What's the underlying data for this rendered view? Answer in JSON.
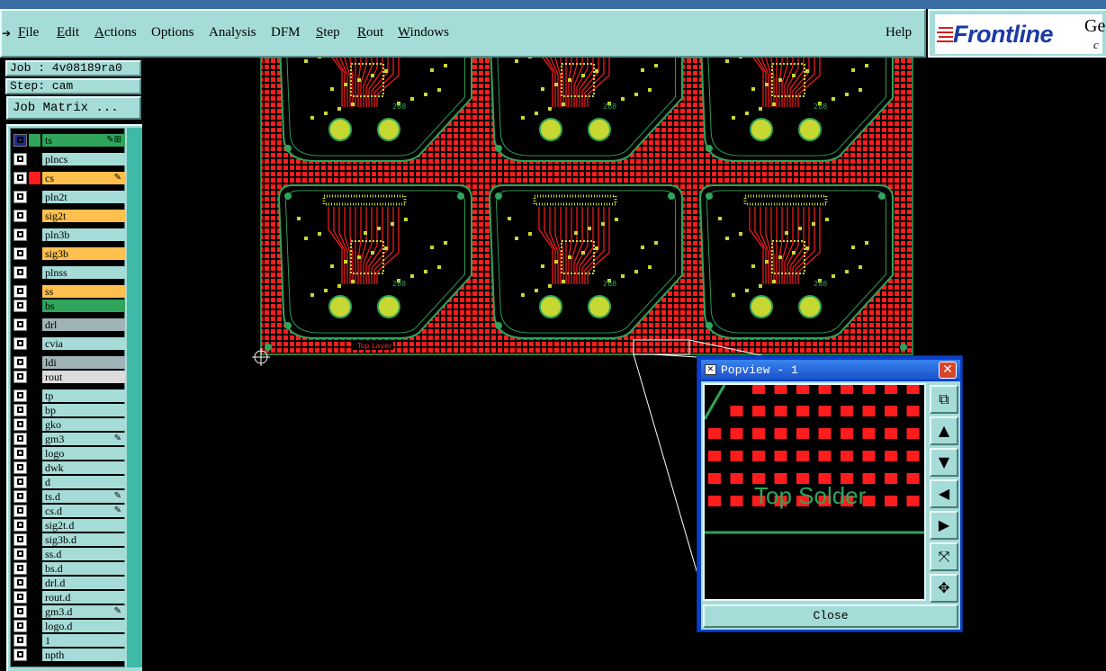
{
  "menu": {
    "items": [
      {
        "label": "File",
        "u": "F",
        "rest": "ile"
      },
      {
        "label": "Edit",
        "u": "E",
        "rest": "dit"
      },
      {
        "label": "Actions",
        "u": "A",
        "rest": "ctions"
      },
      {
        "label": "Options",
        "u": "",
        "rest": "Options"
      },
      {
        "label": "Analysis",
        "u": "",
        "rest": "Analysis"
      },
      {
        "label": "DFM",
        "u": "",
        "rest": "DFM"
      },
      {
        "label": "Step",
        "u": "S",
        "rest": "tep"
      },
      {
        "label": "Rout",
        "u": "R",
        "rest": "out"
      },
      {
        "label": "Windows",
        "u": "W",
        "rest": "indows"
      }
    ],
    "help": "Help"
  },
  "logo": {
    "word": "Frontline",
    "ge": "Ge",
    "c": "c"
  },
  "job_label": "Job : 4v08189ra0",
  "step_label": "Step: cam",
  "job_matrix_button": "Job Matrix ...",
  "layers": [
    {
      "name": "ts",
      "color": "#2ea55a",
      "swatch": "#2ea55a",
      "check_bg": "#1e2a8a",
      "mark": "✎⊞"
    },
    {
      "name": "plncs",
      "color": "#a6dcd8",
      "swatch": "",
      "mark": ""
    },
    {
      "name": "cs",
      "color": "#ffc04d",
      "swatch": "#ff1c1c",
      "mark": "✎"
    },
    {
      "name": "pln2t",
      "color": "#a6dcd8",
      "swatch": "",
      "mark": ""
    },
    {
      "name": "sig2t",
      "color": "#ffc04d",
      "swatch": "",
      "mark": ""
    },
    {
      "name": "pln3b",
      "color": "#a6dcd8",
      "swatch": "",
      "mark": ""
    },
    {
      "name": "sig3b",
      "color": "#ffc04d",
      "swatch": "",
      "mark": ""
    },
    {
      "name": "plnss",
      "color": "#a6dcd8",
      "swatch": "",
      "mark": ""
    },
    {
      "name": "ss",
      "color": "#ffc04d",
      "swatch": "",
      "mark": ""
    },
    {
      "name": "bs",
      "color": "#2ea55a",
      "swatch": "",
      "mark": ""
    },
    {
      "name": "drl",
      "color": "#a0b4b8",
      "swatch": "",
      "mark": ""
    },
    {
      "name": "cvia",
      "color": "#a6dcd8",
      "swatch": "",
      "mark": ""
    },
    {
      "name": "ldi",
      "color": "#a0b4b8",
      "swatch": "",
      "mark": ""
    },
    {
      "name": "rout",
      "color": "#dcdcdc",
      "swatch": "",
      "mark": ""
    },
    {
      "name": "tp",
      "color": "#a6dcd8",
      "swatch": "",
      "mark": ""
    },
    {
      "name": "bp",
      "color": "#a6dcd8",
      "swatch": "",
      "mark": ""
    },
    {
      "name": "gko",
      "color": "#a6dcd8",
      "swatch": "",
      "mark": ""
    },
    {
      "name": "gm3",
      "color": "#a6dcd8",
      "swatch": "",
      "mark": "✎"
    },
    {
      "name": "logo",
      "color": "#a6dcd8",
      "swatch": "",
      "mark": ""
    },
    {
      "name": "dwk",
      "color": "#a6dcd8",
      "swatch": "",
      "mark": ""
    },
    {
      "name": "d",
      "color": "#a6dcd8",
      "swatch": "",
      "mark": ""
    },
    {
      "name": "ts.d",
      "color": "#a6dcd8",
      "swatch": "",
      "mark": "✎"
    },
    {
      "name": "cs.d",
      "color": "#a6dcd8",
      "swatch": "",
      "mark": "✎"
    },
    {
      "name": "sig2t.d",
      "color": "#a6dcd8",
      "swatch": "",
      "mark": ""
    },
    {
      "name": "sig3b.d",
      "color": "#a6dcd8",
      "swatch": "",
      "mark": ""
    },
    {
      "name": "ss.d",
      "color": "#a6dcd8",
      "swatch": "",
      "mark": ""
    },
    {
      "name": "bs.d",
      "color": "#a6dcd8",
      "swatch": "",
      "mark": ""
    },
    {
      "name": "drl.d",
      "color": "#a6dcd8",
      "swatch": "",
      "mark": ""
    },
    {
      "name": "rout.d",
      "color": "#a6dcd8",
      "swatch": "",
      "mark": ""
    },
    {
      "name": "gm3.d",
      "color": "#a6dcd8",
      "swatch": "",
      "mark": "✎"
    },
    {
      "name": "logo.d",
      "color": "#a6dcd8",
      "swatch": "",
      "mark": ""
    },
    {
      "name": "1",
      "color": "#a6dcd8",
      "swatch": "",
      "mark": ""
    },
    {
      "name": "npth",
      "color": "#a6dcd8",
      "swatch": "",
      "mark": ""
    }
  ],
  "board": {
    "colors": {
      "pad": "#ff1c1c",
      "outline": "#2ea55a",
      "silk": "#c8d832",
      "copper": "#ff1c1c"
    },
    "panel_rows": 2,
    "panel_cols": 3,
    "panel_label": "Top Layer",
    "board_mark": "268"
  },
  "popview": {
    "title": "Popview - 1",
    "title_icon": "✕",
    "close_label": "Close",
    "zoom_text": "Top Solder",
    "tools": [
      {
        "name": "zoom-home-icon",
        "glyph": "⧉"
      },
      {
        "name": "pan-up-icon",
        "glyph": "▲"
      },
      {
        "name": "pan-down-icon",
        "glyph": "▼"
      },
      {
        "name": "pan-left-icon",
        "glyph": "◀"
      },
      {
        "name": "pan-right-icon",
        "glyph": "▶"
      },
      {
        "name": "zoom-out-icon",
        "glyph": "⤧"
      },
      {
        "name": "zoom-in-icon",
        "glyph": "✥"
      }
    ]
  }
}
